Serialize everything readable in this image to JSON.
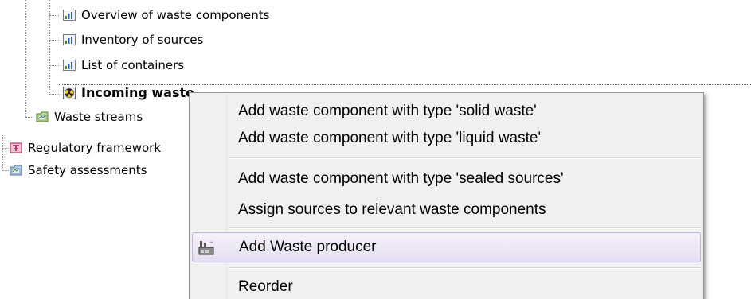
{
  "tree": {
    "items": [
      {
        "label": "Overview of waste components",
        "icon": "chart-report-icon"
      },
      {
        "label": "Inventory of sources",
        "icon": "chart-report-icon"
      },
      {
        "label": "List of containers",
        "icon": "chart-report-icon"
      },
      {
        "label": "Incoming waste",
        "icon": "radioactive-icon",
        "selected": true
      },
      {
        "label": "Waste streams",
        "icon": "map-folder-icon"
      },
      {
        "label": "Regulatory framework",
        "icon": "regulation-icon"
      },
      {
        "label": "Safety assessments",
        "icon": "map-folder-icon"
      }
    ]
  },
  "context_menu": {
    "items": [
      {
        "label": "Add waste component with type 'solid waste'"
      },
      {
        "label": "Add waste component with type 'liquid waste'"
      },
      {
        "label": "Add waste component with type 'sealed sources'"
      },
      {
        "label": "Assign sources to relevant waste components"
      },
      {
        "label": "Add Waste producer",
        "icon": "factory-icon",
        "highlighted": true
      },
      {
        "label": "Reorder"
      }
    ]
  },
  "colors": {
    "menu_background": "#f0f0f0",
    "hover_border": "#c2b9dc",
    "tree_line": "#8c8c8c"
  }
}
